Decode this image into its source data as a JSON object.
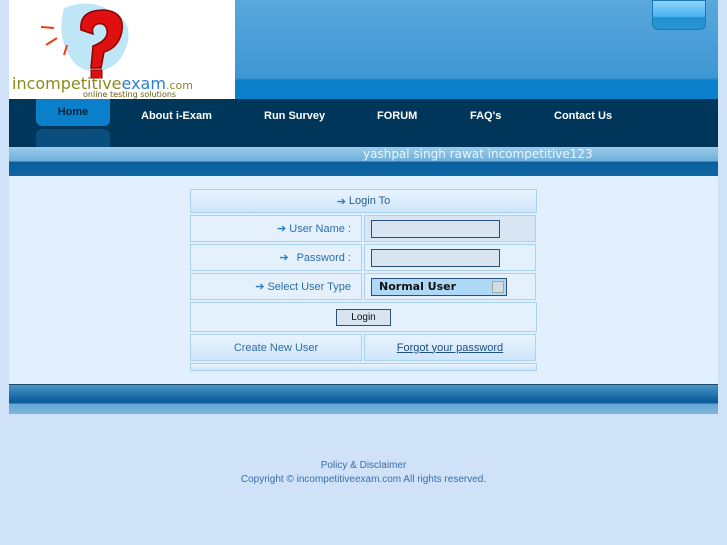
{
  "logo": {
    "part1": "incompetitive",
    "part2": "exam",
    "part3": ".com",
    "tagline": "online testing solutions"
  },
  "nav": {
    "items": [
      {
        "label": "Home"
      },
      {
        "label": "About i-Exam"
      },
      {
        "label": "Run Survey"
      },
      {
        "label": "FORUM"
      },
      {
        "label": "FAQ's"
      },
      {
        "label": "Contact Us"
      }
    ]
  },
  "user": {
    "text": "yashpal singh rawat incompetitive123"
  },
  "login": {
    "title": "Login To",
    "username_label": "User Name :",
    "username_value": "",
    "password_label": "Password :",
    "password_value": "",
    "usertype_label": "Select User Type",
    "usertype_value": "Normal User",
    "button": "Login",
    "create": "Create New User",
    "forgot": "Forgot your password",
    "arrow_icon": "arrow-right-icon"
  },
  "footer": {
    "policy": "Policy & Disclaimer",
    "copyright": "Copyright © incompetitiveexam.com All rights reserved."
  },
  "colors": {
    "nav": "#00365a",
    "accent": "#0a7fca",
    "page": "#d0e2f8"
  }
}
